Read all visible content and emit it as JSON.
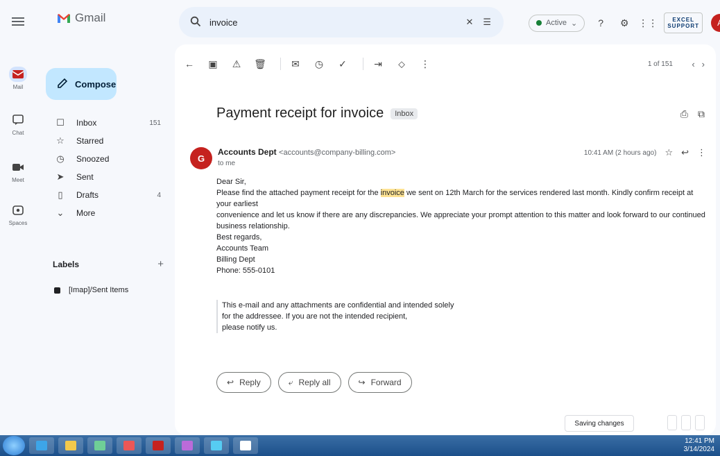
{
  "rail": {
    "items": [
      {
        "label": "Mail",
        "icon": "mail-icon"
      },
      {
        "label": "Chat",
        "icon": "chat-icon"
      },
      {
        "label": "Meet",
        "icon": "video-icon"
      },
      {
        "label": "Spaces",
        "icon": "spaces-icon"
      }
    ]
  },
  "app": {
    "name": "Gmail"
  },
  "compose": {
    "label": "Compose"
  },
  "nav": [
    {
      "label": "Inbox",
      "count": "151",
      "icon": "inbox-icon"
    },
    {
      "label": "Starred",
      "count": "",
      "icon": "star-icon"
    },
    {
      "label": "Snoozed",
      "count": "",
      "icon": "clock-icon"
    },
    {
      "label": "Sent",
      "count": "",
      "icon": "send-icon"
    },
    {
      "label": "Drafts",
      "count": "4",
      "icon": "draft-icon"
    },
    {
      "label": "More",
      "count": "",
      "icon": "chevron-down-icon"
    }
  ],
  "labels": {
    "title": "Labels",
    "items": [
      {
        "label": "[Imap]/Sent Items"
      }
    ]
  },
  "search": {
    "query": "invoice"
  },
  "status": {
    "label": "Active"
  },
  "brand": {
    "line1": "EXCEL",
    "line2": "SUPPORT"
  },
  "user": {
    "initial": "A"
  },
  "toolbar": {
    "pager": "1 of 151"
  },
  "email": {
    "subject": "Payment receipt for invoice",
    "tag": "Inbox",
    "sender_initial": "G",
    "sender_name": "Accounts Dept",
    "sender_addr": "<accounts@company-billing.com>",
    "to": "to me",
    "time": "10:41 AM (2 hours ago)",
    "greeting": "Dear Sir,",
    "line1a": "Please find the attached payment receipt for the",
    "line1hl": "invoice",
    "line1b": "we sent on 12th March for the services rendered last month. Kindly confirm receipt at your earliest",
    "line2": "convenience and let us know if there are any discrepancies. We appreciate your prompt attention to this matter and look forward to our continued",
    "line3": "business relationship.",
    "closing": "Best regards,",
    "name": "Accounts Team",
    "company": "Billing Dept",
    "phone": "Phone: 555-0101",
    "sig1": "This e-mail and any attachments are confidential and intended solely",
    "sig2": "for the addressee. If you are not the intended recipient,",
    "sig3": "please notify us."
  },
  "replies": [
    {
      "label": "Reply",
      "icon": "reply-icon"
    },
    {
      "label": "Reply all",
      "icon": "reply-all-icon"
    },
    {
      "label": "Forward",
      "icon": "forward-icon"
    }
  ],
  "bottom": {
    "pill": "Saving changes"
  },
  "taskbar": {
    "time": "12:41 PM",
    "date": "3/14/2024"
  }
}
